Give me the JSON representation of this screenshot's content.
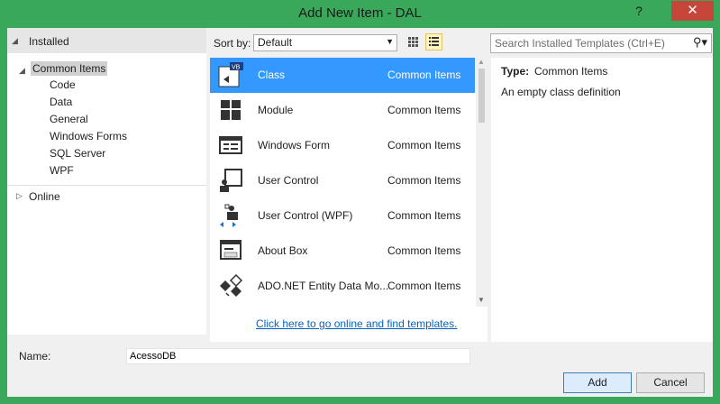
{
  "dialog": {
    "title": "Add New Item - DAL",
    "help_glyph": "?",
    "close_glyph": "✕"
  },
  "tree": {
    "installed": "Installed",
    "common_items": "Common Items",
    "children": [
      "Code",
      "Data",
      "General",
      "Windows Forms",
      "SQL Server",
      "WPF"
    ],
    "online": "Online"
  },
  "toolbar": {
    "sort_label": "Sort by:",
    "sort_value": "Default",
    "search_placeholder": "Search Installed Templates (Ctrl+E)"
  },
  "templates": [
    {
      "name": "Class",
      "category": "Common Items",
      "icon": "vb-class-icon",
      "selected": true
    },
    {
      "name": "Module",
      "category": "Common Items",
      "icon": "module-icon"
    },
    {
      "name": "Windows Form",
      "category": "Common Items",
      "icon": "windows-form-icon"
    },
    {
      "name": "User Control",
      "category": "Common Items",
      "icon": "user-control-icon"
    },
    {
      "name": "User Control (WPF)",
      "category": "Common Items",
      "icon": "wpf-user-control-icon"
    },
    {
      "name": "About Box",
      "category": "Common Items",
      "icon": "about-box-icon"
    },
    {
      "name": "ADO.NET Entity Data Mo...",
      "category": "Common Items",
      "icon": "entity-data-model-icon"
    }
  ],
  "online_link": "Click here to go online and find templates.",
  "details": {
    "type_label": "Type:",
    "type_value": "Common Items",
    "description": "An empty class definition"
  },
  "footer": {
    "name_label": "Name:",
    "name_value": "AcessoDB",
    "add_label": "Add",
    "cancel_label": "Cancel"
  },
  "colors": {
    "titlebar": "#3aa85a",
    "selection": "#3399ff",
    "close": "#c7463a"
  }
}
